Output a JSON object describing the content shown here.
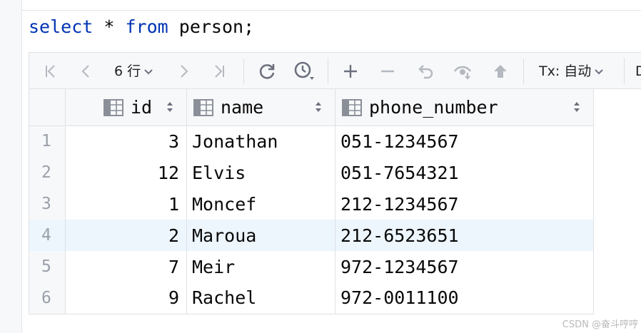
{
  "editor": {
    "sql_keyword_select": "select",
    "sql_star": "*",
    "sql_keyword_from": "from",
    "sql_table": "person;"
  },
  "toolbar": {
    "row_count": "6 行",
    "tx_label": "Tx: 自动",
    "cut_off_label": "D",
    "icons": [
      "first-page-icon",
      "previous-page-icon",
      "next-page-icon",
      "last-page-icon",
      "reload-icon",
      "history-icon",
      "add-row-icon",
      "delete-row-icon",
      "revert-icon",
      "view-icon",
      "submit-icon"
    ]
  },
  "grid": {
    "columns": [
      "id",
      "name",
      "phone_number"
    ],
    "rows": [
      {
        "num": "1",
        "id": "3",
        "name": "Jonathan",
        "phone": "051-1234567"
      },
      {
        "num": "2",
        "id": "12",
        "name": "Elvis",
        "phone": "051-7654321"
      },
      {
        "num": "3",
        "id": "1",
        "name": "Moncef",
        "phone": "212-1234567"
      },
      {
        "num": "4",
        "id": "2",
        "name": "Maroua",
        "phone": "212-6523651"
      },
      {
        "num": "5",
        "id": "7",
        "name": "Meir",
        "phone": "972-1234567"
      },
      {
        "num": "6",
        "id": "9",
        "name": "Rachel",
        "phone": "972-0011100"
      }
    ],
    "selected_row_index": 3
  },
  "watermark": "CSDN @奋斗哼哼",
  "colors": {
    "keyword": "#0033b3",
    "selected_row": "#edf5fd",
    "toolbar_bg": "#f7f8fa"
  }
}
